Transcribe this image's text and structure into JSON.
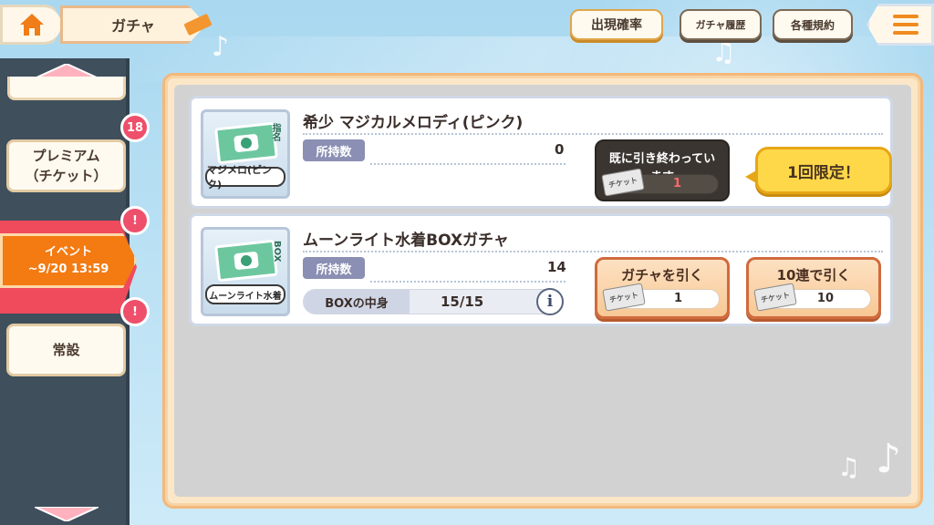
{
  "header": {
    "title": "ガチャ",
    "buttons": {
      "probability": "出現確率",
      "history": "ガチャ履歴",
      "terms": "各種規約"
    }
  },
  "sidebar": {
    "items": [
      {
        "label_line1": "プレミアム",
        "label_line2": "（チケット）",
        "badge": "18"
      },
      {
        "label_line1": "イベント",
        "label_line2": "~9/20 13:59",
        "badge": "!"
      },
      {
        "label_line1": "常設",
        "label_line2": "",
        "badge": "!"
      }
    ]
  },
  "gacha": [
    {
      "title": "希少 マジカルメロディ(ピンク)",
      "thumb_label": "マジメロ(ピンク)",
      "thumb_tag": "指名",
      "owned_label": "所持数",
      "owned_value": "0",
      "button_text_line1": "既に引き終わってい",
      "button_text_line2": "ます",
      "ticket_label": "チケット",
      "ticket_count": "1",
      "limited_label": "1回限定！"
    },
    {
      "title": "ムーンライト水着BOXガチャ",
      "thumb_label": "ムーンライト水着",
      "thumb_tag": "BOX",
      "owned_label": "所持数",
      "owned_value": "14",
      "box_label": "BOXの中身",
      "box_value": "15/15",
      "info_icon": "i",
      "single_label": "ガチャを引く",
      "single_ticket_label": "チケット",
      "single_ticket_count": "1",
      "multi_label": "10連で引く",
      "multi_ticket_label": "チケット",
      "multi_ticket_count": "10"
    }
  ],
  "colors": {
    "accent_orange": "#f47a12",
    "badge_red": "#ee4f6b",
    "sidebar_dark": "#3f4f5c"
  }
}
